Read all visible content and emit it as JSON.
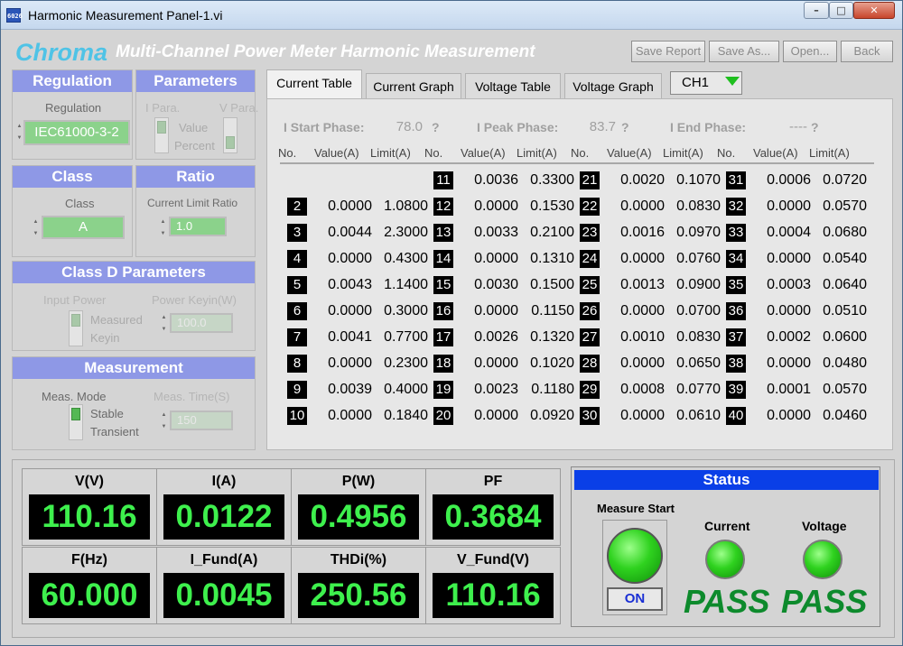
{
  "window": {
    "title": "Harmonic Measurement Panel-1.vi",
    "app_icon_text": "6026"
  },
  "header": {
    "logo": "Chroma",
    "title": "Multi-Channel Power Meter Harmonic Measurement",
    "buttons": [
      "Save Report",
      "Save As...",
      "Open...",
      "Back"
    ]
  },
  "regulation": {
    "title": "Regulation",
    "label": "Regulation",
    "value": "IEC61000-3-2"
  },
  "parameters": {
    "title": "Parameters",
    "i_para": "I Para.",
    "v_para": "V Para.",
    "value": "Value",
    "percent": "Percent"
  },
  "class": {
    "title": "Class",
    "label": "Class",
    "value": "A"
  },
  "ratio": {
    "title": "Ratio",
    "label": "Current Limit Ratio",
    "value": "1.0"
  },
  "class_d": {
    "title": "Class D Parameters",
    "input_power": "Input Power",
    "power_keyin": "Power Keyin(W)",
    "measured": "Measured",
    "keyin": "Keyin",
    "value": "100.0"
  },
  "measurement": {
    "title": "Measurement",
    "mode_label": "Meas. Mode",
    "time_label": "Meas. Time(S)",
    "stable": "Stable",
    "transient": "Transient",
    "time_value": "150"
  },
  "tabs": [
    "Current Table",
    "Current Graph",
    "Voltage Table",
    "Voltage Graph"
  ],
  "channel": "CH1",
  "phases": {
    "start_label": "I Start Phase:",
    "start_value": "78.0",
    "peak_label": "I Peak Phase:",
    "peak_value": "83.7",
    "end_label": "I End Phase:",
    "end_value": "----",
    "help": "?"
  },
  "table_headers": {
    "no": "No.",
    "value": "Value(A)",
    "limit": "Limit(A)"
  },
  "harmonics": [
    [
      {
        "no": "",
        "value": "",
        "limit": ""
      },
      {
        "no": "2",
        "value": "0.0000",
        "limit": "1.0800"
      },
      {
        "no": "3",
        "value": "0.0044",
        "limit": "2.3000"
      },
      {
        "no": "4",
        "value": "0.0000",
        "limit": "0.4300"
      },
      {
        "no": "5",
        "value": "0.0043",
        "limit": "1.1400"
      },
      {
        "no": "6",
        "value": "0.0000",
        "limit": "0.3000"
      },
      {
        "no": "7",
        "value": "0.0041",
        "limit": "0.7700"
      },
      {
        "no": "8",
        "value": "0.0000",
        "limit": "0.2300"
      },
      {
        "no": "9",
        "value": "0.0039",
        "limit": "0.4000"
      },
      {
        "no": "10",
        "value": "0.0000",
        "limit": "0.1840"
      }
    ],
    [
      {
        "no": "11",
        "value": "0.0036",
        "limit": "0.3300"
      },
      {
        "no": "12",
        "value": "0.0000",
        "limit": "0.1530"
      },
      {
        "no": "13",
        "value": "0.0033",
        "limit": "0.2100"
      },
      {
        "no": "14",
        "value": "0.0000",
        "limit": "0.1310"
      },
      {
        "no": "15",
        "value": "0.0030",
        "limit": "0.1500"
      },
      {
        "no": "16",
        "value": "0.0000",
        "limit": "0.1150"
      },
      {
        "no": "17",
        "value": "0.0026",
        "limit": "0.1320"
      },
      {
        "no": "18",
        "value": "0.0000",
        "limit": "0.1020"
      },
      {
        "no": "19",
        "value": "0.0023",
        "limit": "0.1180"
      },
      {
        "no": "20",
        "value": "0.0000",
        "limit": "0.0920"
      }
    ],
    [
      {
        "no": "21",
        "value": "0.0020",
        "limit": "0.1070"
      },
      {
        "no": "22",
        "value": "0.0000",
        "limit": "0.0830"
      },
      {
        "no": "23",
        "value": "0.0016",
        "limit": "0.0970"
      },
      {
        "no": "24",
        "value": "0.0000",
        "limit": "0.0760"
      },
      {
        "no": "25",
        "value": "0.0013",
        "limit": "0.0900"
      },
      {
        "no": "26",
        "value": "0.0000",
        "limit": "0.0700"
      },
      {
        "no": "27",
        "value": "0.0010",
        "limit": "0.0830"
      },
      {
        "no": "28",
        "value": "0.0000",
        "limit": "0.0650"
      },
      {
        "no": "29",
        "value": "0.0008",
        "limit": "0.0770"
      },
      {
        "no": "30",
        "value": "0.0000",
        "limit": "0.0610"
      }
    ],
    [
      {
        "no": "31",
        "value": "0.0006",
        "limit": "0.0720"
      },
      {
        "no": "32",
        "value": "0.0000",
        "limit": "0.0570"
      },
      {
        "no": "33",
        "value": "0.0004",
        "limit": "0.0680"
      },
      {
        "no": "34",
        "value": "0.0000",
        "limit": "0.0540"
      },
      {
        "no": "35",
        "value": "0.0003",
        "limit": "0.0640"
      },
      {
        "no": "36",
        "value": "0.0000",
        "limit": "0.0510"
      },
      {
        "no": "37",
        "value": "0.0002",
        "limit": "0.0600"
      },
      {
        "no": "38",
        "value": "0.0000",
        "limit": "0.0480"
      },
      {
        "no": "39",
        "value": "0.0001",
        "limit": "0.0570"
      },
      {
        "no": "40",
        "value": "0.0000",
        "limit": "0.0460"
      }
    ]
  ],
  "meters": [
    {
      "label": "V(V)",
      "value": "110.16"
    },
    {
      "label": "I(A)",
      "value": "0.0122"
    },
    {
      "label": "P(W)",
      "value": "0.4956"
    },
    {
      "label": "PF",
      "value": "0.3684"
    },
    {
      "label": "F(Hz)",
      "value": "60.000"
    },
    {
      "label": "I_Fund(A)",
      "value": "0.0045"
    },
    {
      "label": "THDi(%)",
      "value": "250.56"
    },
    {
      "label": "V_Fund(V)",
      "value": "110.16"
    }
  ],
  "status": {
    "title": "Status",
    "measure_start": "Measure Start",
    "on": "ON",
    "current": "Current",
    "voltage": "Voltage",
    "current_result": "PASS",
    "voltage_result": "PASS"
  },
  "colors": {
    "panel_header": "#8e98e6",
    "status_bar": "#0a3fe7",
    "meter_text": "#3ef04d",
    "pass": "#0d8a2c"
  }
}
